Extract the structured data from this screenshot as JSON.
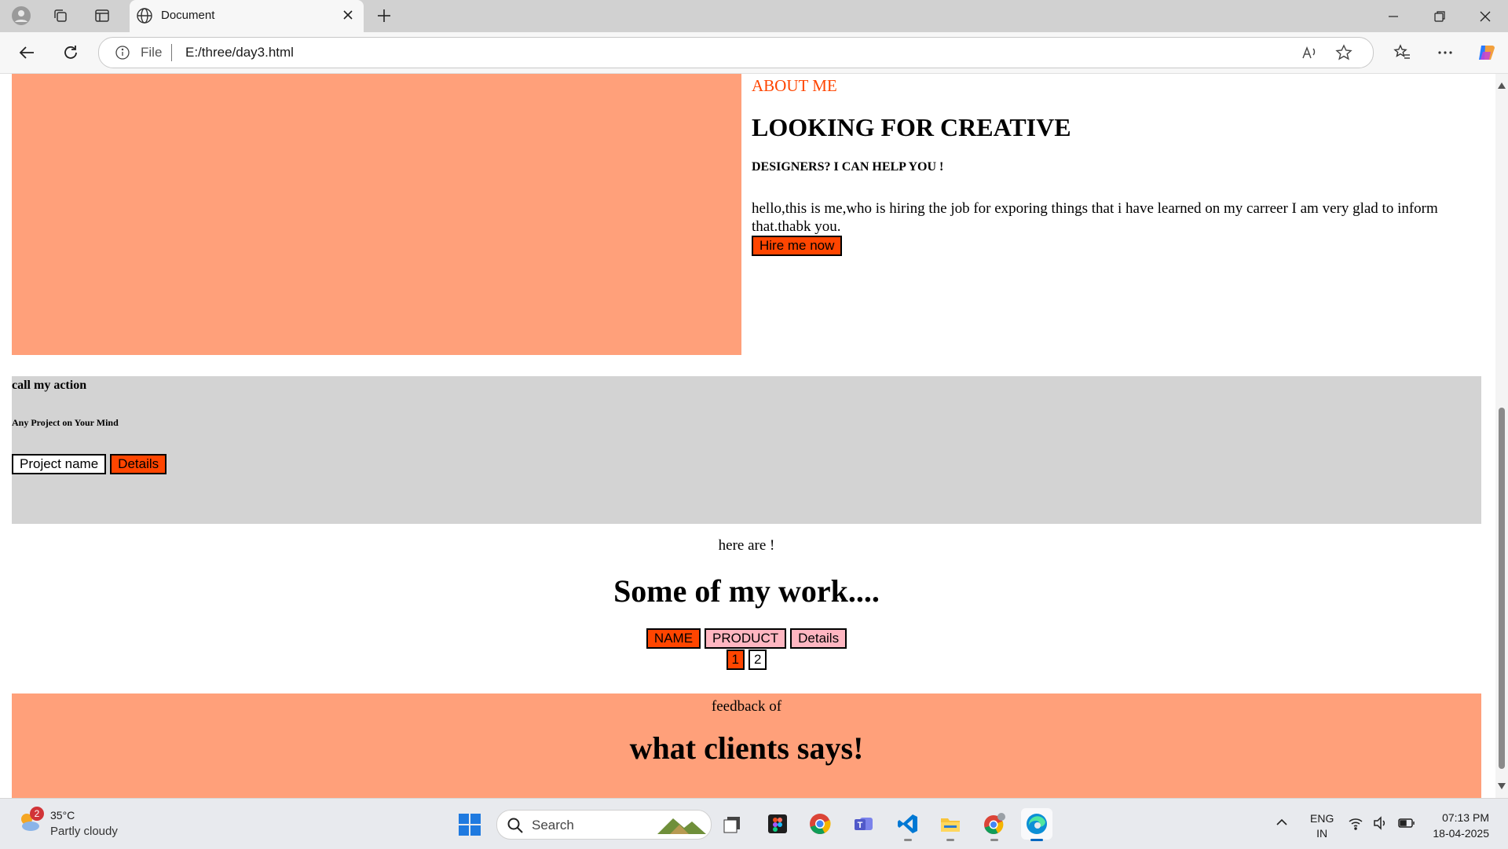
{
  "browser": {
    "tab_title": "Document",
    "address": {
      "scheme_label": "File",
      "url": "E:/three/day3.html"
    }
  },
  "page": {
    "about": {
      "kicker": "ABOUT ME",
      "title": "LOOKING FOR CREATIVE",
      "subtitle": "DESIGNERS? I CAN HELP YOU !",
      "paragraph": "hello,this is me,who is hiring the job for exporing things that i have learned on my carreer I am very glad to inform that.thabk you.",
      "hire_button": "Hire me now",
      "image_color": "#ffa07a"
    },
    "cta": {
      "title": "call my action",
      "subtitle": "Any Project on Your Mind",
      "project_button": "Project name",
      "details_button": "Details",
      "background": "#d3d3d3"
    },
    "work": {
      "kicker": "here are !",
      "title": "Some of my work....",
      "tabs": [
        "NAME",
        "PRODUCT",
        "Details"
      ],
      "pages": [
        "1",
        "2"
      ]
    },
    "feedback": {
      "kicker": "feedback of",
      "title": "what clients says!"
    },
    "accent_color": "#ff4500"
  },
  "taskbar": {
    "weather": {
      "badge": "2",
      "temp": "35°C",
      "condition": "Partly cloudy"
    },
    "search_label": "Search",
    "language": [
      "ENG",
      "IN"
    ],
    "time": "07:13 PM",
    "date": "18-04-2025"
  }
}
